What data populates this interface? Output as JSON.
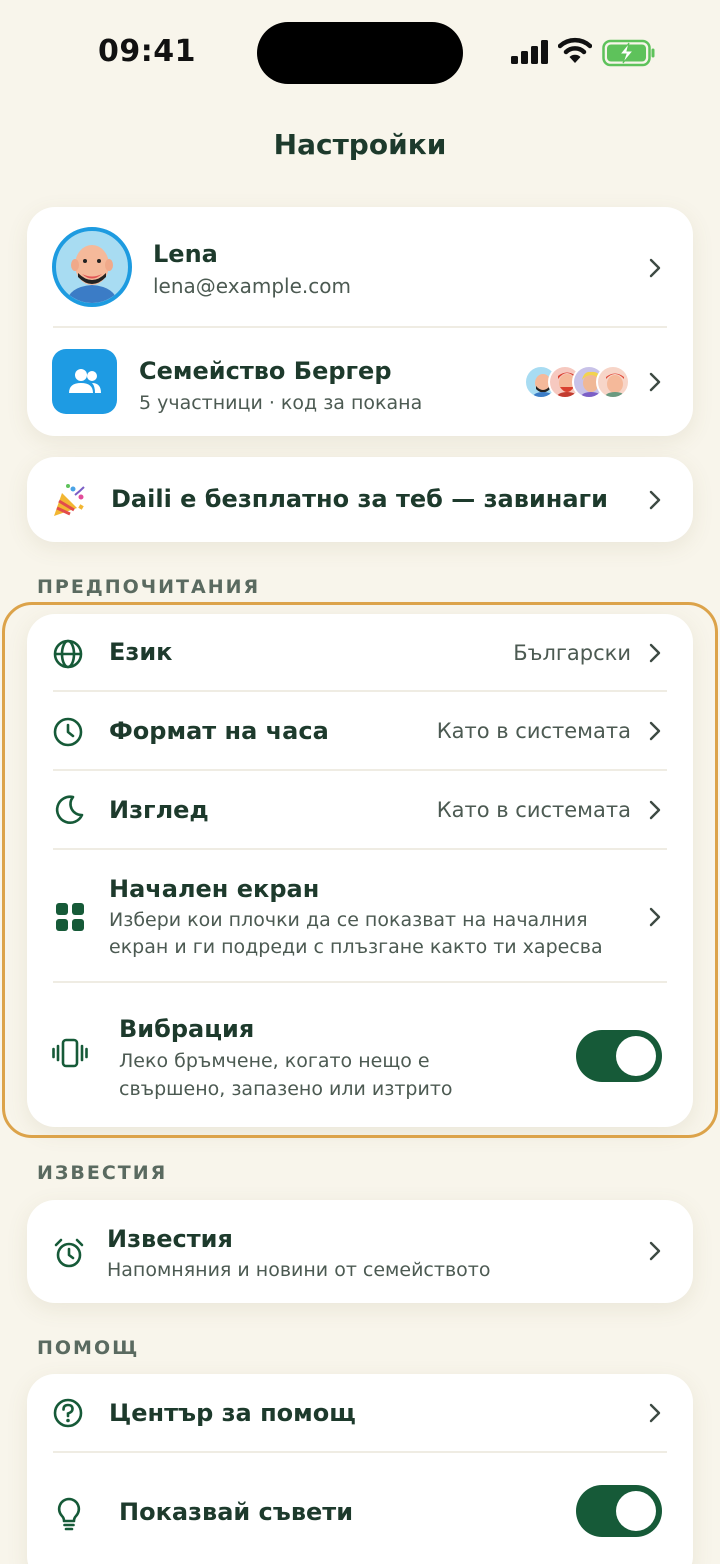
{
  "status_bar": {
    "time": "09:41"
  },
  "header": {
    "title": "Настройки"
  },
  "profile": {
    "name": "Lena",
    "email": "lena@example.com"
  },
  "family": {
    "name": "Семейство Бергер",
    "subtitle": "5 участници · код за покана"
  },
  "promo": {
    "text": "Daili е безплатно за теб — завинаги"
  },
  "sections": {
    "preferences": "ПРЕДПОЧИТАНИЯ",
    "notifications": "ИЗВЕСТИЯ",
    "help": "ПОМОЩ"
  },
  "preferences": {
    "language": {
      "label": "Език",
      "value": "Български"
    },
    "time_format": {
      "label": "Формат на часа",
      "value": "Като в системата"
    },
    "appearance": {
      "label": "Изглед",
      "value": "Като в системата"
    },
    "home_screen": {
      "label": "Начален екран",
      "desc_line1": "Избери кои плочки да се показват на началния",
      "desc_line2": "екран и ги подреди с плъзгане както ти харесва"
    },
    "vibration": {
      "label": "Вибрация",
      "desc_line1": "Леко бръмчене, когато нещо е",
      "desc_line2": "свършено, запазено или изтрито",
      "enabled": true
    }
  },
  "notifications": {
    "label": "Известия",
    "subtitle": "Напомняния и новини от семейството"
  },
  "help": {
    "help_center": {
      "label": "Център за помощ"
    },
    "show_tips": {
      "label": "Показвай съвети",
      "enabled": true
    }
  },
  "colors": {
    "accent": "#165a38",
    "family_icon_bg": "#1e9be3",
    "highlight": "#dca34a",
    "background": "#f8f5eb"
  }
}
